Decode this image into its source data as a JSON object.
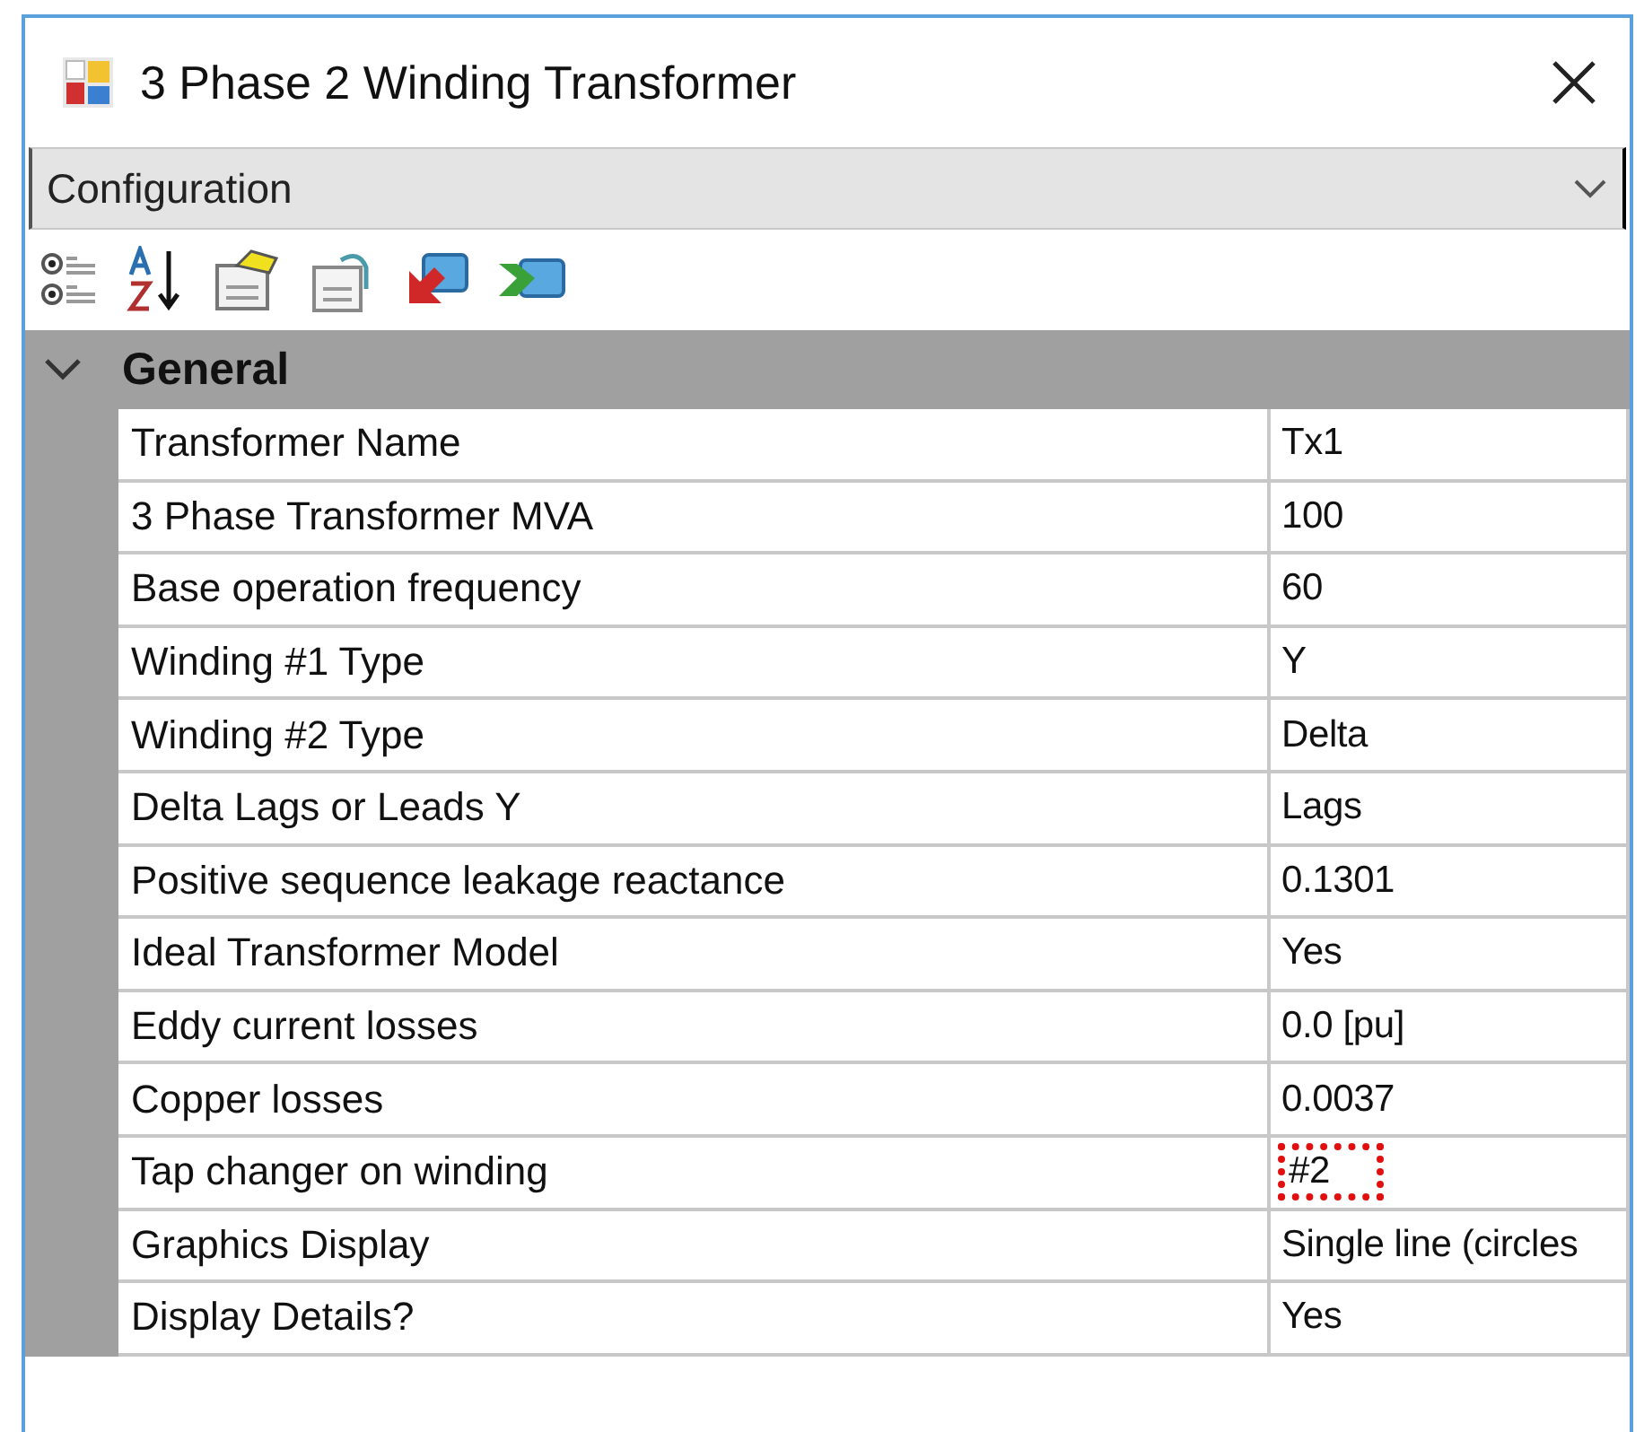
{
  "window": {
    "title": "3 Phase 2 Winding Transformer"
  },
  "dropdown": {
    "value": "Configuration"
  },
  "category": {
    "label": "General",
    "expanded": true
  },
  "properties": [
    {
      "name": "Transformer Name",
      "value": "Tx1",
      "highlighted": false
    },
    {
      "name": "3 Phase Transformer MVA",
      "value": "100",
      "highlighted": false
    },
    {
      "name": "Base operation frequency",
      "value": "60",
      "highlighted": false
    },
    {
      "name": "Winding #1 Type",
      "value": "Y",
      "highlighted": false
    },
    {
      "name": "Winding #2 Type",
      "value": "Delta",
      "highlighted": false
    },
    {
      "name": "Delta Lags or Leads Y",
      "value": "Lags",
      "highlighted": false
    },
    {
      "name": "Positive sequence leakage reactance",
      "value": "0.1301",
      "highlighted": false
    },
    {
      "name": "Ideal Transformer Model",
      "value": "Yes",
      "highlighted": false
    },
    {
      "name": "Eddy current losses",
      "value": "0.0 [pu]",
      "highlighted": false
    },
    {
      "name": "Copper losses",
      "value": "0.0037",
      "highlighted": false
    },
    {
      "name": "Tap changer on winding",
      "value": "#2",
      "highlighted": true
    },
    {
      "name": "Graphics Display",
      "value": "Single line (circles",
      "highlighted": false
    },
    {
      "name": "Display Details?",
      "value": "Yes",
      "highlighted": false
    }
  ]
}
